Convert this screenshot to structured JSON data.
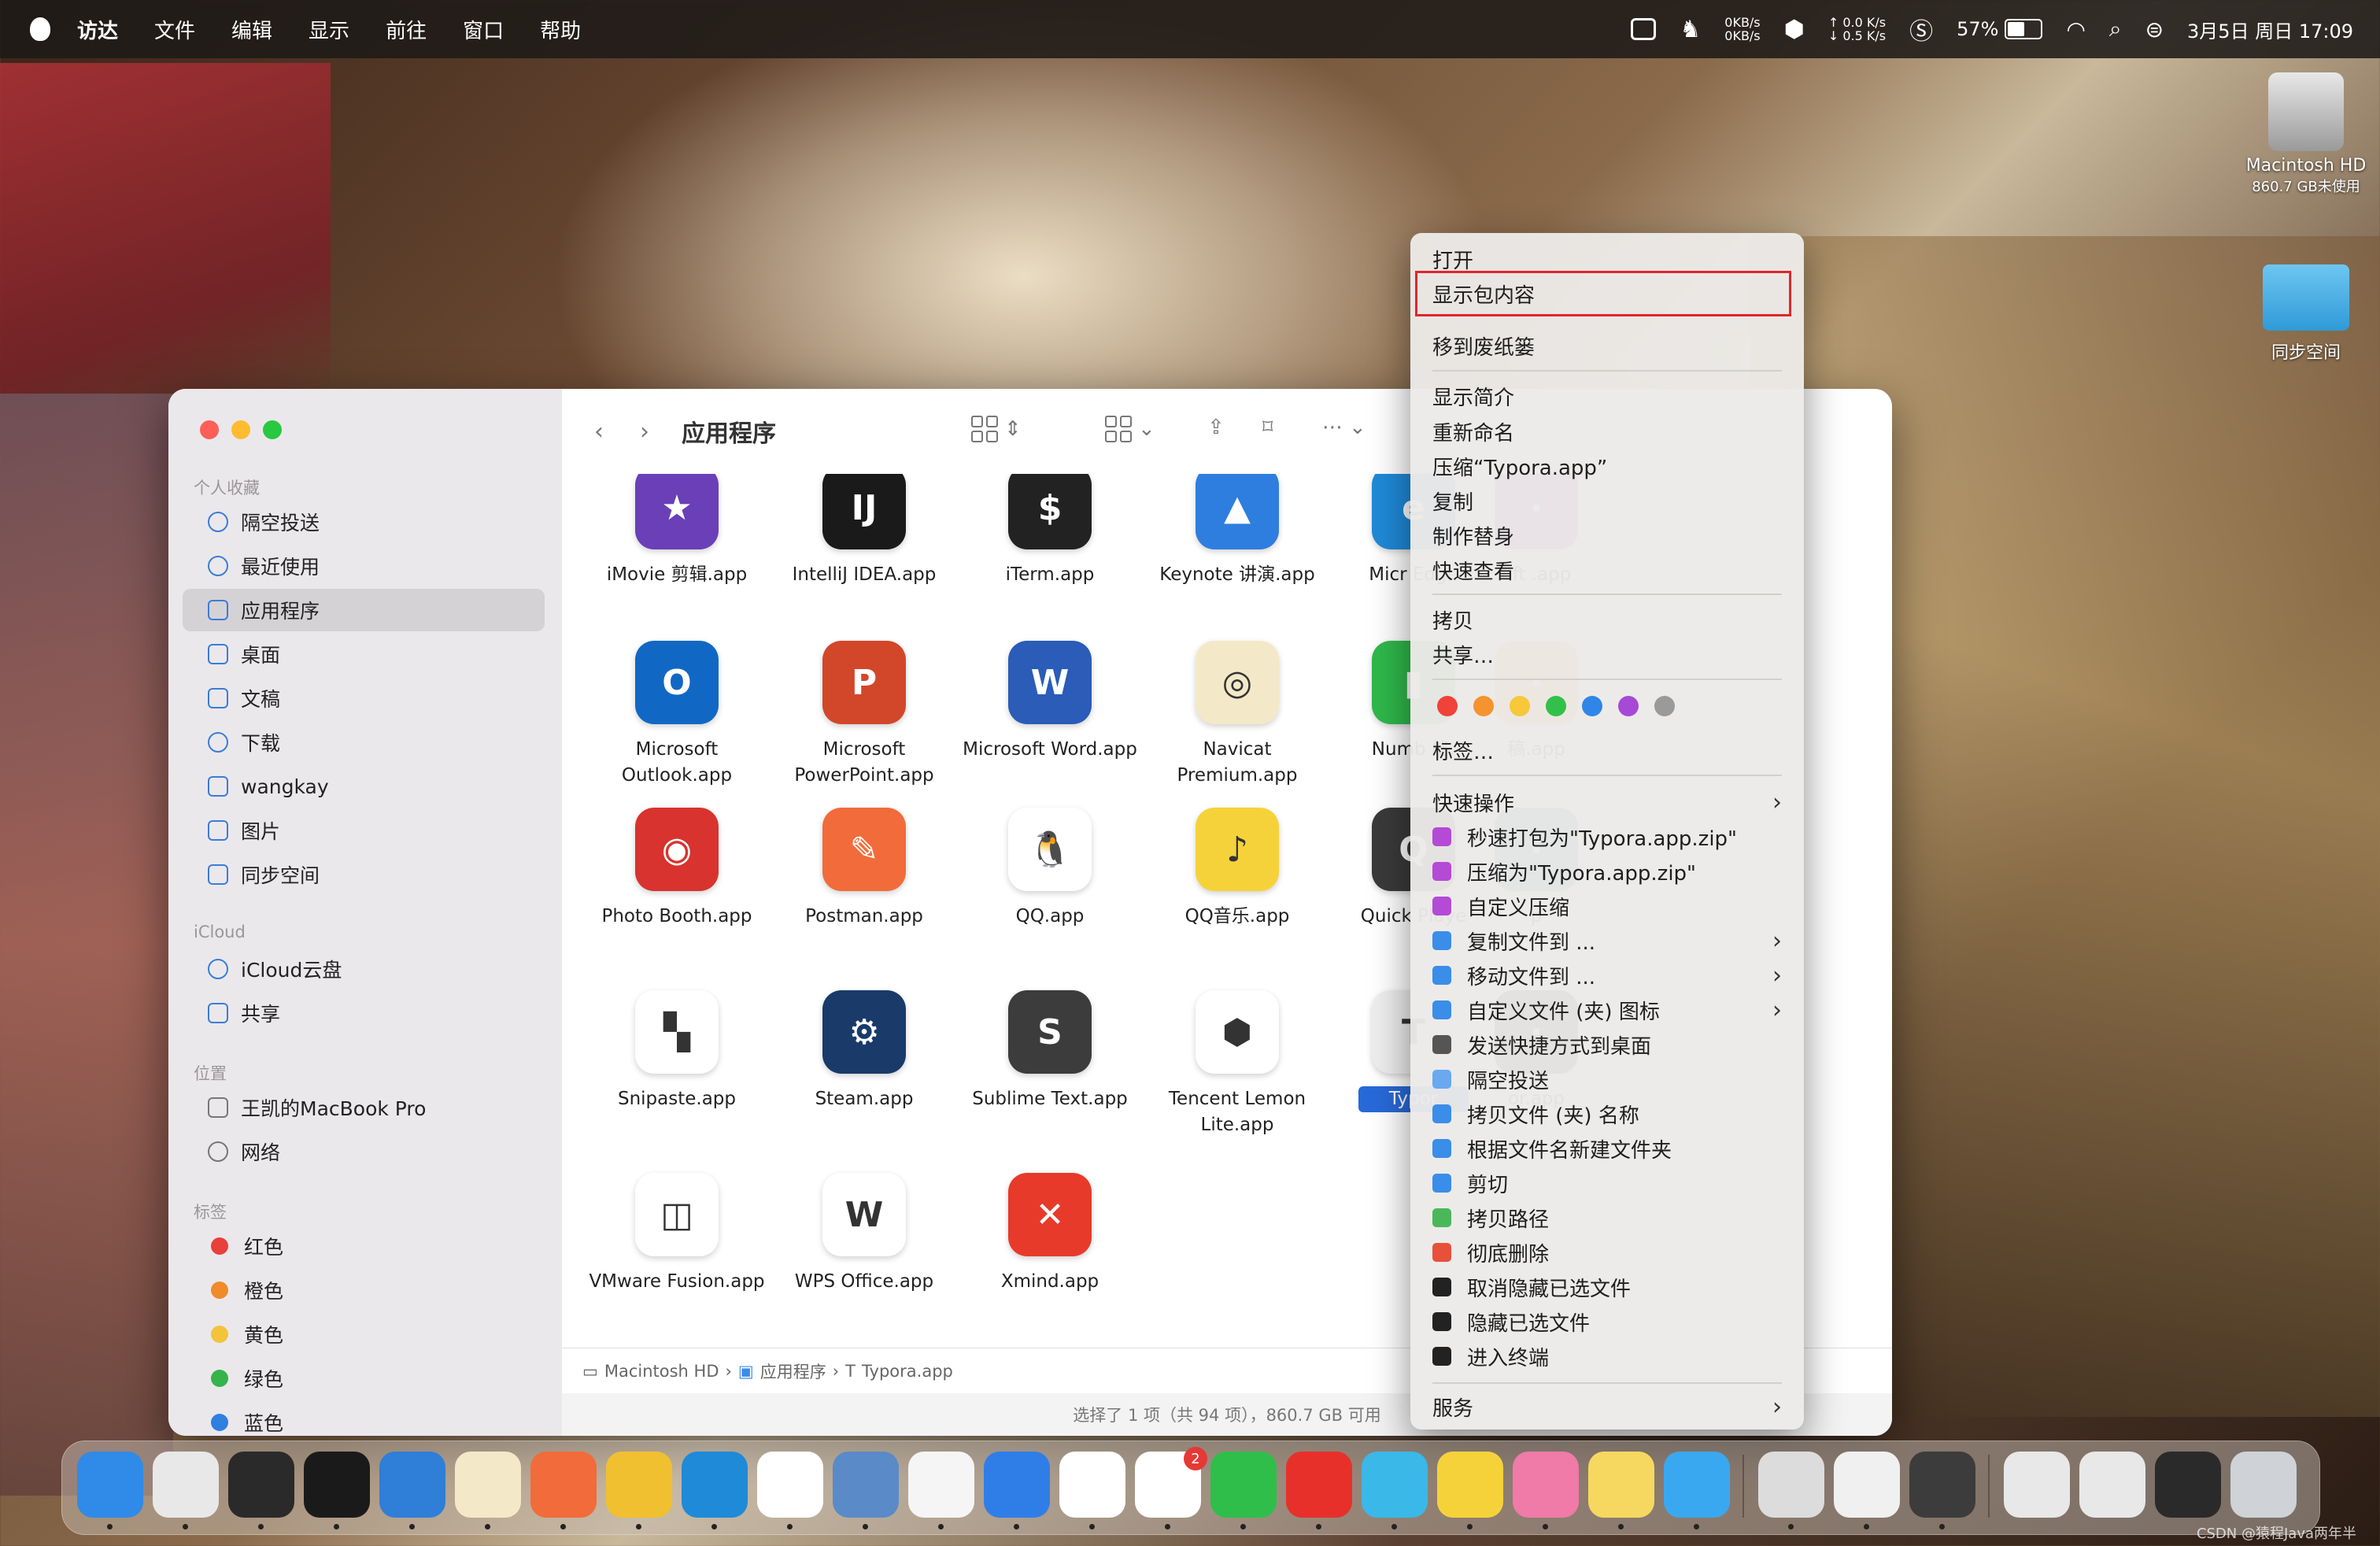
{
  "menubar": {
    "app_name": "访达",
    "items": [
      "文件",
      "编辑",
      "显示",
      "前往",
      "窗口",
      "帮助"
    ],
    "net_up": "0KB/s",
    "net_down": "0KB/s",
    "speed_up": "↑ 0.0 K/s",
    "speed_down": "↓ 0.5 K/s",
    "battery": "57%",
    "battery_level": 0.57,
    "datetime": "3月5日 周日  17:09"
  },
  "desktop": {
    "hd_name": "Macintosh HD",
    "hd_sub": "860.7 GB未使用",
    "folder_name": "同步空间"
  },
  "finder": {
    "title": "应用程序",
    "sidebar": {
      "section_favorites": "个人收藏",
      "favorites": [
        "隔空投送",
        "最近使用",
        "应用程序",
        "桌面",
        "文稿",
        "下载",
        "wangkay",
        "图片",
        "同步空间"
      ],
      "section_icloud": "iCloud",
      "icloud": [
        "iCloud云盘",
        "共享"
      ],
      "section_locations": "位置",
      "locations": [
        "王凯的MacBook Pro",
        "网络"
      ],
      "section_tags": "标签",
      "tags": [
        {
          "name": "红色",
          "color": "#e8403a"
        },
        {
          "name": "橙色",
          "color": "#f08a2a"
        },
        {
          "name": "黄色",
          "color": "#f3c33a"
        },
        {
          "name": "绿色",
          "color": "#35b44a"
        },
        {
          "name": "蓝色",
          "color": "#2f7fe0"
        }
      ]
    },
    "apps_row1": [
      {
        "name": "iMovie 剪辑.app",
        "color": "#6a3fb8",
        "glyph": "★"
      },
      {
        "name": "IntelliJ IDEA.app",
        "color": "#1a1a1a",
        "glyph": "IJ"
      },
      {
        "name": "iTerm.app",
        "color": "#222222",
        "glyph": "$"
      },
      {
        "name": "Keynote 讲演.app",
        "color": "#2e7ee0",
        "glyph": "▲"
      },
      {
        "name": "Micr Edge",
        "color": "#1f8ad8",
        "glyph": "e"
      },
      {
        "name": "oft .app",
        "color": "#9a3fc8",
        "glyph": "·"
      }
    ],
    "apps_row2": [
      {
        "name": "Microsoft Outlook.app",
        "color": "#1168c4",
        "glyph": "O"
      },
      {
        "name": "Microsoft PowerPoint.app",
        "color": "#d2472a",
        "glyph": "P"
      },
      {
        "name": "Microsoft Word.app",
        "color": "#2a5cb8",
        "glyph": "W"
      },
      {
        "name": "Navicat Premium.app",
        "color": "#f3e9c8",
        "glyph": "◎"
      },
      {
        "name": "Numb 格.",
        "color": "#2fb84a",
        "glyph": "▮"
      },
      {
        "name": "稿.app",
        "color": "#f2a23a",
        "glyph": "·"
      }
    ],
    "apps_row3": [
      {
        "name": "Photo Booth.app",
        "color": "#d8332e",
        "glyph": "◉"
      },
      {
        "name": "Postman.app",
        "color": "#f26b3a",
        "glyph": "✎"
      },
      {
        "name": "QQ.app",
        "color": "#ffffff",
        "glyph": "🐧"
      },
      {
        "name": "QQ音乐.app",
        "color": "#f6d23a",
        "glyph": "♪"
      },
      {
        "name": "Quick Playe",
        "color": "#3a3a3a",
        "glyph": "Q"
      },
      {
        "name": "p",
        "color": "#2a7ab8",
        "glyph": "·"
      }
    ],
    "apps_row4": [
      {
        "name": "Snipaste.app",
        "color": "#ffffff",
        "glyph": "▚"
      },
      {
        "name": "Steam.app",
        "color": "#1a3a6a",
        "glyph": "⚙"
      },
      {
        "name": "Sublime Text.app",
        "color": "#3c3c3c",
        "glyph": "S"
      },
      {
        "name": "Tencent Lemon Lite.app",
        "color": "#ffffff",
        "glyph": "⬢"
      },
      {
        "name": "Typor",
        "color": "#eeeeee",
        "glyph": "T"
      },
      {
        "name": "or.app",
        "color": "#222222",
        "glyph": "·"
      }
    ],
    "apps_row5": [
      {
        "name": "VMware Fusion.app",
        "color": "#ffffff",
        "glyph": "◫"
      },
      {
        "name": "WPS Office.app",
        "color": "#ffffff",
        "glyph": "W"
      },
      {
        "name": "Xmind.app",
        "color": "#e83a2a",
        "glyph": "✕"
      }
    ],
    "path": [
      "Macintosh HD",
      "应用程序",
      "Typora.app"
    ],
    "status": "选择了 1 项（共 94 项），860.7 GB 可用"
  },
  "context_menu": {
    "open": "打开",
    "show_package": "显示包内容",
    "trash": "移到废纸篓",
    "get_info": "显示简介",
    "rename": "重新命名",
    "compress": "压缩“Typora.app”",
    "duplicate": "复制",
    "alias": "制作替身",
    "quicklook": "快速查看",
    "copy": "拷贝",
    "share": "共享…",
    "tag_colors": [
      "#f0423a",
      "#f5932e",
      "#f6c83a",
      "#33c04a",
      "#2f86e8",
      "#a64ad6",
      "#9a9a9a"
    ],
    "tags": "标签…",
    "quick_actions": "快速操作",
    "extras": [
      {
        "label": "秒速打包为\"Typora.app.zip\"",
        "color": "#b44ad6",
        "arrow": ""
      },
      {
        "label": "压缩为\"Typora.app.zip\"",
        "color": "#b44ad6",
        "arrow": ""
      },
      {
        "label": "自定义压缩",
        "color": "#b44ad6",
        "arrow": ""
      },
      {
        "label": "复制文件到 ...",
        "color": "#3a8de8",
        "arrow": "›"
      },
      {
        "label": "移动文件到 ...",
        "color": "#3a8de8",
        "arrow": "›"
      },
      {
        "label": "自定义文件 (夹) 图标",
        "color": "#3a8de8",
        "arrow": "›"
      },
      {
        "label": "发送快捷方式到桌面",
        "color": "#555555",
        "arrow": ""
      },
      {
        "label": "隔空投送",
        "color": "#6aa8f0",
        "arrow": ""
      },
      {
        "label": "拷贝文件 (夹) 名称",
        "color": "#3a8de8",
        "arrow": ""
      },
      {
        "label": "根据文件名新建文件夹",
        "color": "#3a8de8",
        "arrow": ""
      },
      {
        "label": "剪切",
        "color": "#3a8de8",
        "arrow": ""
      },
      {
        "label": "拷贝路径",
        "color": "#4ab85a",
        "arrow": ""
      },
      {
        "label": "彻底删除",
        "color": "#e8503a",
        "arrow": ""
      },
      {
        "label": "取消隐藏已选文件",
        "color": "#222222",
        "arrow": ""
      },
      {
        "label": "隐藏已选文件",
        "color": "#222222",
        "arrow": ""
      },
      {
        "label": "进入终端",
        "color": "#222222",
        "arrow": ""
      }
    ],
    "services": "服务"
  },
  "dock": {
    "apps": [
      {
        "name": "finder",
        "color": "#2f8ae8"
      },
      {
        "name": "launchpad",
        "color": "#e8e8e8"
      },
      {
        "name": "activity-monitor",
        "color": "#2a2a2a"
      },
      {
        "name": "intellij",
        "color": "#1a1a1a"
      },
      {
        "name": "vscode",
        "color": "#2f7ed8"
      },
      {
        "name": "navicat",
        "color": "#f3e9c8"
      },
      {
        "name": "postman",
        "color": "#f26b3a"
      },
      {
        "name": "chrome",
        "color": "#f0c030"
      },
      {
        "name": "edge",
        "color": "#1f8ad8"
      },
      {
        "name": "vmware",
        "color": "#ffffff"
      },
      {
        "name": "screen-sharing",
        "color": "#5a8ac8"
      },
      {
        "name": "textedit",
        "color": "#f5f5f5"
      },
      {
        "name": "lanhu",
        "color": "#2f7ee8"
      },
      {
        "name": "wps",
        "color": "#ffffff"
      },
      {
        "name": "qq",
        "color": "#ffffff"
      },
      {
        "name": "wechat",
        "color": "#2fbe4a"
      },
      {
        "name": "netease-music",
        "color": "#e8302a"
      },
      {
        "name": "infuse",
        "color": "#3ab8e8"
      },
      {
        "name": "qq-music",
        "color": "#f6d23a"
      },
      {
        "name": "bilibili",
        "color": "#f07aa8"
      },
      {
        "name": "notes",
        "color": "#f6d860"
      },
      {
        "name": "mail-app",
        "color": "#3aa8f0"
      },
      {
        "name": "preview",
        "color": "#dcdcdc"
      },
      {
        "name": "typora",
        "color": "#f0f0f0"
      },
      {
        "name": "sublime",
        "color": "#3c3c3c"
      }
    ],
    "qq_badge": "2",
    "watermark": "CSDN @猿程Java两年半"
  }
}
